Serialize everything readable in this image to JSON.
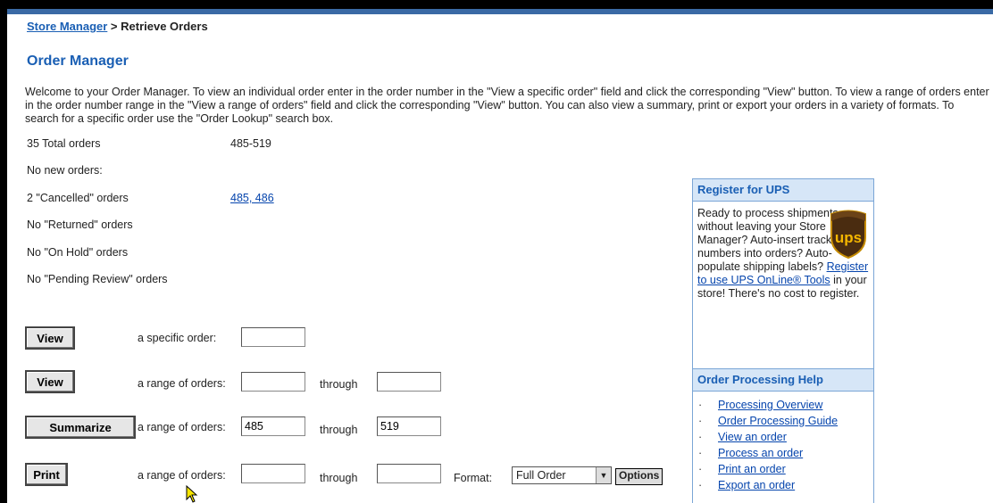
{
  "breadcrumb": {
    "link": "Store Manager",
    "separator": " > ",
    "current": "Retrieve Orders"
  },
  "title": "Order Manager",
  "intro": "Welcome to your Order Manager. To view an individual order enter in the order number in the \"View a specific order\" field and click the corresponding \"View\" button. To view a range of orders enter in the order number range in the \"View a range of orders\" field and click the corresponding \"View\" button. You can also view a summary, print or export your orders in a variety of formats. To search for a specific order use the \"Order Lookup\" search box.",
  "stats": [
    {
      "label": "35 Total orders",
      "value": "485-519",
      "is_link": false
    },
    {
      "label": "No new orders:",
      "value": "",
      "is_link": false
    },
    {
      "label": "2 \"Cancelled\" orders",
      "value": "485, 486",
      "is_link": true
    },
    {
      "label": "No \"Returned\" orders",
      "value": "",
      "is_link": false
    },
    {
      "label": "No \"On Hold\" orders",
      "value": "",
      "is_link": false
    },
    {
      "label": "No \"Pending Review\" orders",
      "value": "",
      "is_link": false
    }
  ],
  "actions": {
    "view_specific": {
      "button": "View",
      "label": "a specific order:",
      "value": ""
    },
    "view_range": {
      "button": "View",
      "label": "a range of orders:",
      "from": "",
      "through_label": "through",
      "to": ""
    },
    "summarize": {
      "button": "Summarize",
      "label": "a range of orders:",
      "from": "485",
      "through_label": "through",
      "to": "519"
    },
    "print": {
      "button": "Print",
      "label": "a range of orders:",
      "from": "",
      "through_label": "through",
      "to": "",
      "format_label": "Format:",
      "format_value": "Full Order",
      "options_label": "Options"
    }
  },
  "ups_panel": {
    "header": "Register for UPS",
    "text_before": "Ready to process shipments without leaving your Store Manager? Auto-insert tracking numbers into orders? Auto-populate shipping labels? ",
    "link": "Register to use UPS OnLine® Tools",
    "text_after": " in your store! There's no cost to register.",
    "logo_text": "ups"
  },
  "help_panel": {
    "header": "Order Processing Help",
    "bullet": "·",
    "items": [
      "Processing Overview",
      "Order Processing Guide",
      "View an order",
      "Process an order",
      "Print an order",
      "Export an order"
    ]
  },
  "colors": {
    "link": "#0645ad",
    "title": "#1a5fb4",
    "panel_header_bg": "#d6e6f7",
    "panel_border": "#7ba6d6"
  }
}
